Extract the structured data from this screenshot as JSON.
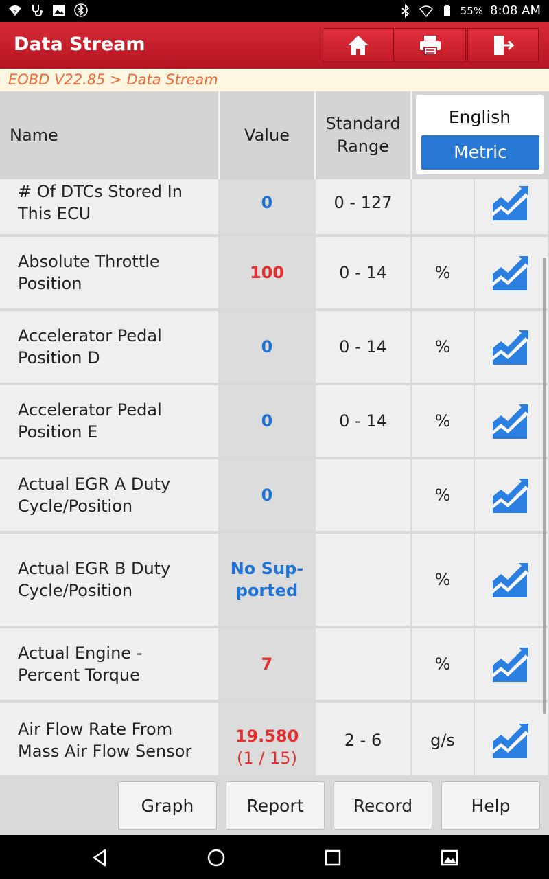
{
  "status_bar": {
    "battery": "55%",
    "time": "8:08 AM"
  },
  "header": {
    "title": "Data Stream",
    "buttons": [
      "home-icon",
      "print-icon",
      "exit-icon"
    ]
  },
  "breadcrumb": "EOBD V22.85 > Data Stream",
  "table": {
    "headers": {
      "name": "Name",
      "value": "Value",
      "range_line1": "Standard",
      "range_line2": "Range"
    },
    "unit_toggle": {
      "english": "English",
      "metric": "Metric",
      "selected": "Metric"
    },
    "rows": [
      {
        "name_l1": "# Of DTCs Stored In",
        "name_l2": "This ECU",
        "value_l1": "0",
        "value_l2": "",
        "value_color": "blue",
        "range": "0 - 127",
        "unit": ""
      },
      {
        "name_l1": "Absolute Throttle",
        "name_l2": "Position",
        "value_l1": "100",
        "value_l2": "",
        "value_color": "red",
        "range": "0 - 14",
        "unit": "%"
      },
      {
        "name_l1": "Accelerator Pedal",
        "name_l2": "Position D",
        "value_l1": "0",
        "value_l2": "",
        "value_color": "blue",
        "range": "0 - 14",
        "unit": "%"
      },
      {
        "name_l1": "Accelerator Pedal",
        "name_l2": "Position E",
        "value_l1": "0",
        "value_l2": "",
        "value_color": "blue",
        "range": "0 - 14",
        "unit": "%"
      },
      {
        "name_l1": "Actual EGR A Duty",
        "name_l2": "Cycle/Position",
        "value_l1": "0",
        "value_l2": "",
        "value_color": "blue",
        "range": "",
        "unit": "%"
      },
      {
        "name_l1": "Actual EGR B Duty",
        "name_l2": "Cycle/Position",
        "value_l1": "No Sup-",
        "value_l2": "ported",
        "value_color": "blue",
        "range": "",
        "unit": "%"
      },
      {
        "name_l1": "Actual Engine -",
        "name_l2": "Percent Torque",
        "value_l1": "7",
        "value_l2": "",
        "value_color": "red",
        "range": "",
        "unit": "%"
      },
      {
        "name_l1": "Air Flow Rate From",
        "name_l2": "Mass Air Flow Sensor",
        "value_l1": "19.580",
        "value_l2": "(1 / 15)",
        "value_color": "red",
        "range": "2 - 6",
        "unit": "g/s"
      }
    ]
  },
  "bottom_buttons": [
    "Graph",
    "Report",
    "Record",
    "Help"
  ],
  "colors": {
    "header_red": "#c01b27",
    "accent_blue": "#2878d6",
    "value_blue": "#1f72d8",
    "value_red": "#e03030",
    "breadcrumb_orange": "#f06a3a"
  }
}
